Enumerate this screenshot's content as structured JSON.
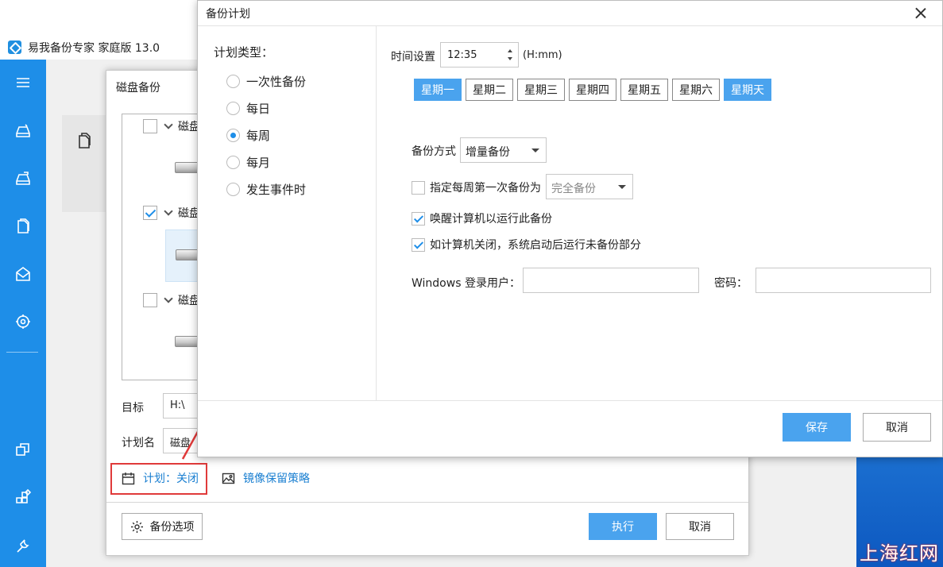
{
  "app": {
    "title": "易我备份专家 家庭版 13.0"
  },
  "sidebar": {
    "icons": [
      "menu-icon",
      "disk-backup-icon",
      "system-backup-icon",
      "file-backup-icon",
      "mail-backup-icon",
      "smart-backup-icon",
      "clone-icon",
      "windows-tools-icon",
      "wrench-icon"
    ]
  },
  "disk_dialog": {
    "title": "磁盘备份",
    "tree": [
      {
        "label": "磁盘",
        "checked": false
      },
      {
        "label": "磁盘",
        "checked": true
      },
      {
        "label": "磁盘",
        "checked": false
      }
    ],
    "target_label": "目标",
    "target_value": "H:\\",
    "plan_name_label": "计划名",
    "plan_name_value": "磁盘",
    "schedule_link": "计划：关闭",
    "retention_link": "镜像保留策略",
    "backup_options_label": "备份选项",
    "execute_label": "执行",
    "cancel_label": "取消"
  },
  "plan_dialog": {
    "title": "备份计划",
    "plan_type_label": "计划类型：",
    "plan_types": [
      {
        "label": "一次性备份",
        "selected": false
      },
      {
        "label": "每日",
        "selected": false
      },
      {
        "label": "每周",
        "selected": true
      },
      {
        "label": "每月",
        "selected": false
      },
      {
        "label": "发生事件时",
        "selected": false
      }
    ],
    "time_label": "时间设置",
    "time_value": "12:35",
    "time_hint": "(H:mm)",
    "days": [
      {
        "label": "星期一",
        "active": true
      },
      {
        "label": "星期二",
        "active": false
      },
      {
        "label": "星期三",
        "active": false
      },
      {
        "label": "星期四",
        "active": false
      },
      {
        "label": "星期五",
        "active": false
      },
      {
        "label": "星期六",
        "active": false
      },
      {
        "label": "星期天",
        "active": true
      }
    ],
    "method_label": "备份方式",
    "method_value": "增量备份",
    "first_week_label": "指定每周第一次备份为",
    "first_week_checked": false,
    "first_week_value": "完全备份",
    "wake_label": "唤醒计算机以运行此备份",
    "wake_checked": true,
    "resume_label": "如计算机关闭，系统启动后运行未备份部分",
    "resume_checked": true,
    "win_user_label": "Windows 登录用户：",
    "win_user_value": "",
    "password_label": "密码：",
    "password_value": "",
    "save_label": "保存",
    "cancel_label": "取消"
  },
  "colors": {
    "sidebar": "#1e8ee8",
    "accent": "#4aa3ee",
    "link": "#1a7fd1",
    "highlight_box": "#e03a3a",
    "arrow": "#e03a3a"
  },
  "watermark": "上海红网"
}
